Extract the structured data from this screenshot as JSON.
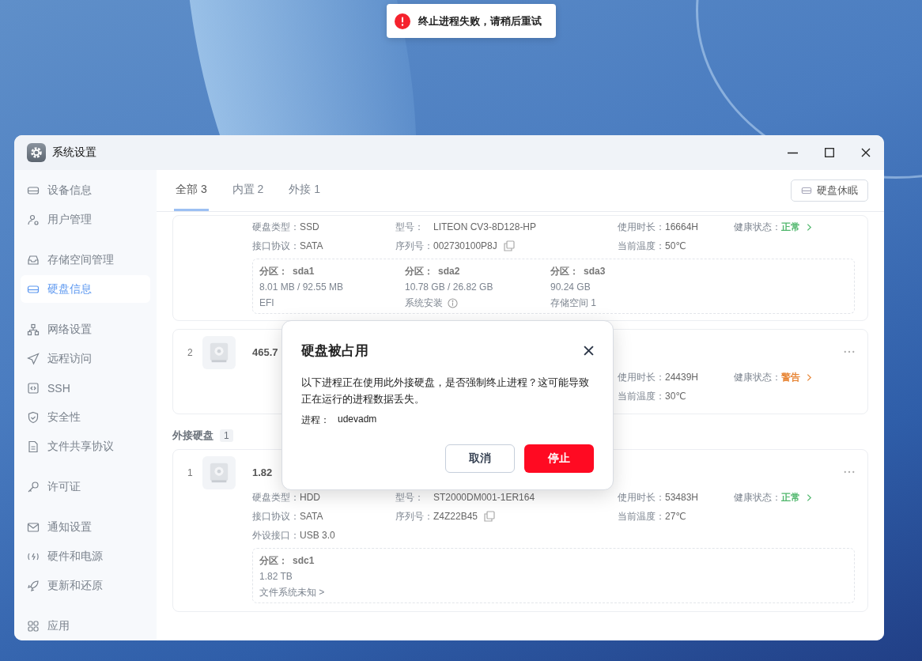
{
  "toast": {
    "text": "终止进程失败，请稍后重试"
  },
  "window": {
    "title": "系统设置"
  },
  "sidebar": {
    "groups": [
      [
        {
          "label": "设备信息",
          "selected": false
        },
        {
          "label": "用户管理",
          "selected": false
        }
      ],
      [
        {
          "label": "存储空间管理",
          "selected": false
        },
        {
          "label": "硬盘信息",
          "selected": true
        }
      ],
      [
        {
          "label": "网络设置",
          "selected": false
        },
        {
          "label": "远程访问",
          "selected": false
        },
        {
          "label": "SSH",
          "selected": false
        },
        {
          "label": "安全性",
          "selected": false
        },
        {
          "label": "文件共享协议",
          "selected": false
        }
      ],
      [
        {
          "label": "许可证",
          "selected": false
        }
      ],
      [
        {
          "label": "通知设置",
          "selected": false
        },
        {
          "label": "硬件和电源",
          "selected": false
        },
        {
          "label": "更新和还原",
          "selected": false
        }
      ],
      [
        {
          "label": "应用",
          "selected": false
        }
      ]
    ]
  },
  "tabs": [
    {
      "label": "全部 3",
      "selected": true
    },
    {
      "label": "内置 2",
      "selected": false
    },
    {
      "label": "外接 1",
      "selected": false
    }
  ],
  "hibernate_button": {
    "label": "硬盘休眠"
  },
  "internal_disks": [
    {
      "basic": [
        {
          "label": "硬盘类型：",
          "value": "SSD"
        },
        {
          "label": "接口协议：",
          "value": "SATA"
        }
      ],
      "model": [
        {
          "label": "型号：",
          "value": "LITEON CV3-8D128-HP",
          "copyable": false
        },
        {
          "label": "序列号：",
          "value": "002730100P8J",
          "copyable": true
        }
      ],
      "runtime": [
        {
          "label": "使用时长：",
          "value": "16664H"
        },
        {
          "label": "当前温度：",
          "value": "50℃"
        }
      ],
      "health": {
        "label": "健康状态：",
        "value": "正常",
        "color": "#52b86e"
      },
      "partitions": [
        {
          "label": "分区：",
          "name": "sda1",
          "size": "8.01 MB / 92.55 MB",
          "usage": "EFI",
          "info": false
        },
        {
          "label": "分区：",
          "name": "sda2",
          "size": "10.78 GB / 26.82 GB",
          "usage": "系统安装",
          "info": true
        },
        {
          "label": "分区：",
          "name": "sda3",
          "size": "90.24 GB",
          "usage": "存储空间 1",
          "info": false
        }
      ]
    },
    {
      "number": "2",
      "name": "465.7",
      "runtime": [
        {
          "label": "使用时长：",
          "value": "24439H"
        },
        {
          "label": "当前温度：",
          "value": "30℃"
        }
      ],
      "health": {
        "label": "健康状态：",
        "value": "警告",
        "color": "#e8883a"
      }
    }
  ],
  "external_section": {
    "title": "外接硬盘",
    "count": "1",
    "disks": [
      {
        "number": "1",
        "name": "1.82",
        "basic": [
          {
            "label": "硬盘类型：",
            "value": "HDD"
          },
          {
            "label": "接口协议：",
            "value": "SATA"
          },
          {
            "label": "外设接口：",
            "value": "USB 3.0"
          }
        ],
        "model": [
          {
            "label": "型号：",
            "value": "ST2000DM001-1ER164",
            "copyable": false
          },
          {
            "label": "序列号：",
            "value": "Z4Z22B45",
            "copyable": true
          }
        ],
        "runtime": [
          {
            "label": "使用时长：",
            "value": "53483H"
          },
          {
            "label": "当前温度：",
            "value": "27℃"
          }
        ],
        "health": {
          "label": "健康状态：",
          "value": "正常",
          "color": "#52b86e"
        },
        "partitions": [
          {
            "label": "分区：",
            "name": "sdc1",
            "size": "1.82 TB",
            "usage": "文件系统未知 >",
            "info": false
          }
        ]
      }
    ]
  },
  "dialog": {
    "title": "硬盘被占用",
    "message": "以下进程正在使用此外接硬盘，是否强制终止进程？这可能导致正在运行的进程数据丢失。",
    "process_label": "进程：",
    "process": "udevadm",
    "buttons": [
      {
        "label": "取消",
        "kind": "secondary"
      },
      {
        "label": "停止",
        "kind": "danger"
      }
    ]
  }
}
